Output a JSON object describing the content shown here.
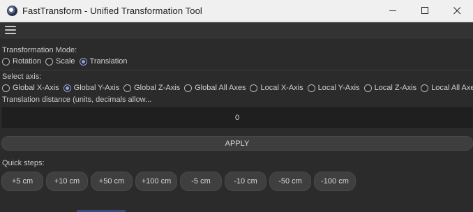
{
  "window": {
    "title": "FastTransform - Unified Transformation Tool",
    "icon": "cinema4d-app-icon"
  },
  "menubar": {
    "icon": "hamburger-menu-icon"
  },
  "mode": {
    "label": "Transformation Mode:",
    "options": [
      "Rotation",
      "Scale",
      "Translation"
    ],
    "selected": "Translation"
  },
  "axis": {
    "label": "Select axis:",
    "options": [
      "Global X-Axis",
      "Global Y-Axis",
      "Global Z-Axis",
      "Global All Axes",
      "Local X-Axis",
      "Local Y-Axis",
      "Local Z-Axis",
      "Local All Axes"
    ],
    "selected": "Global Y-Axis"
  },
  "distance": {
    "label": "Translation distance (units, decimals allow...",
    "value": "0"
  },
  "apply": {
    "label": "APPLY"
  },
  "quick": {
    "label": "Quick steps:",
    "steps": [
      "+5 cm",
      "+10 cm",
      "+50 cm",
      "+100 cm",
      "-5 cm",
      "-10 cm",
      "-50 cm",
      "-100 cm"
    ]
  },
  "colors": {
    "accent": "#8fa3d9",
    "background": "#2b2b2b",
    "titlebar": "#f0f0f0"
  }
}
